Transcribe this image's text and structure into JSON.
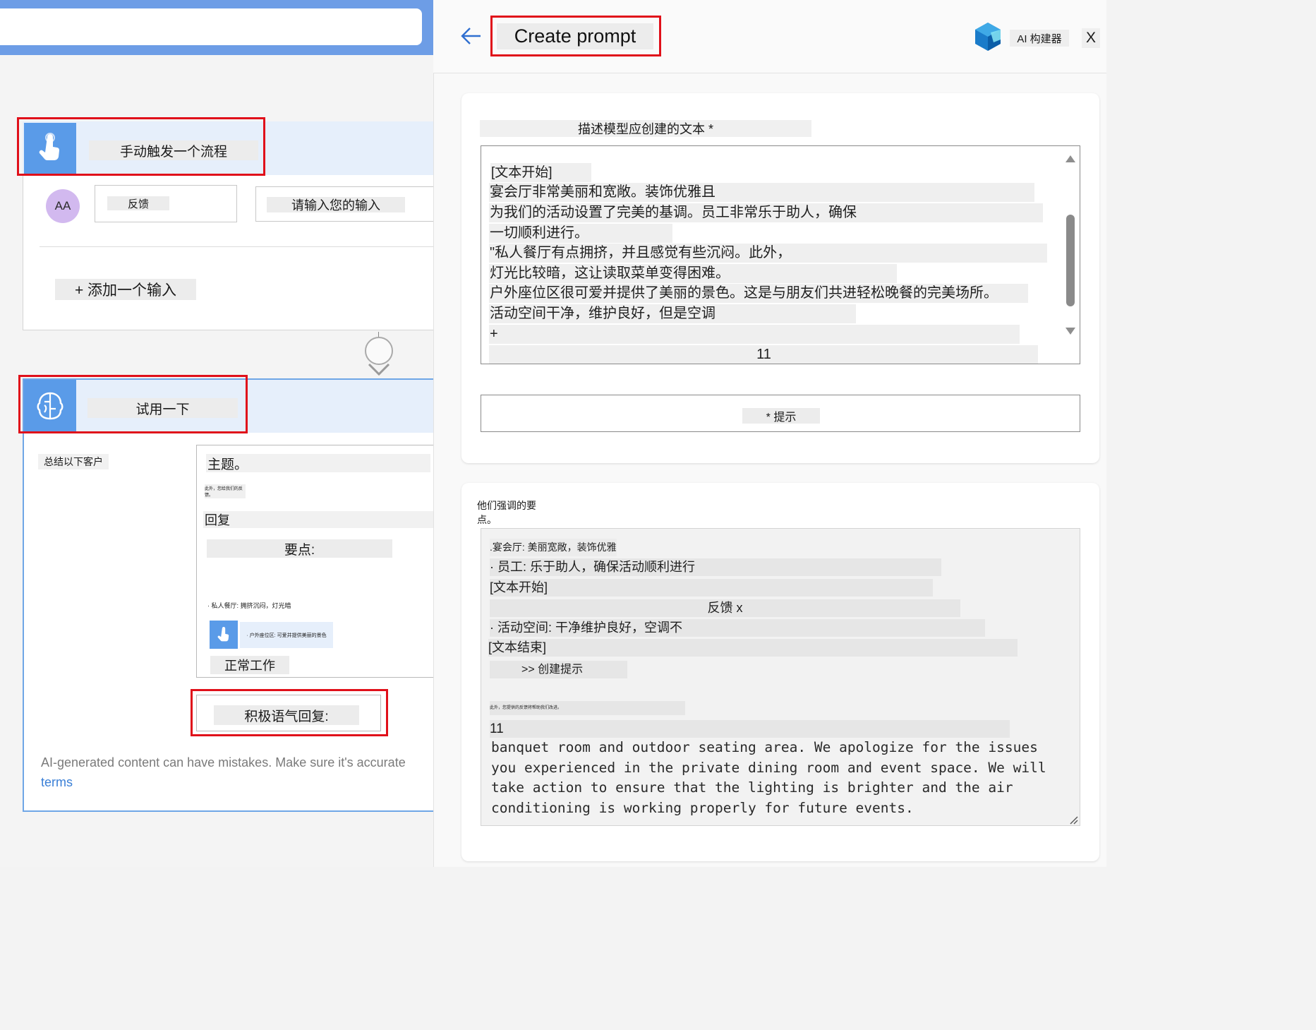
{
  "flow": {
    "trigger": {
      "title": "手动触发一个流程",
      "avatar": "AA",
      "field_name": "反馈",
      "field_placeholder": "请输入您的输入",
      "add_input": "+ 添加一个输入"
    },
    "ai_step": {
      "title": "试用一下",
      "summarize_label": "总结以下客户",
      "preview": {
        "subject": "主题。",
        "tiny_line": "此外，您给我们的反馈。",
        "reply": "回复",
        "key_points": "要点:",
        "private_room": "· 私人餐厅: 拥挤沉闷，灯光暗",
        "outdoor": "· 户外座位区: 可爱并提供美丽的景色",
        "normal": "正常工作"
      },
      "positive_reply": "积极语气回复:",
      "disclaimer": "AI-generated content can have mistakes. Make sure it's accurate",
      "terms_link": "terms"
    }
  },
  "panel": {
    "title": "Create prompt",
    "product_label": "AI 构建器",
    "close_label": "X",
    "description_label": "描述模型应创建的文本 *",
    "prompt_lines": [
      "[文本开始]",
      "宴会厅非常美丽和宽敞。装饰优雅且",
      "为我们的活动设置了完美的基调。员工非常乐于助人，确保",
      "一切顺利进行。",
      "\"私人餐厅有点拥挤，并且感觉有些沉闷。此外，",
      "灯光比较暗，这让读取菜单变得困难。",
      "户外座位区很可爱并提供了美丽的景色。这是与朋友们共进轻松晚餐的完美场所。",
      "活动空间干净，维护良好，但是空调",
      "+",
      "11"
    ],
    "hint_label": "* 提示",
    "key_points_label": "他们强调的要点。",
    "output_lines": [
      ".宴会厅: 美丽宽敞，装饰优雅",
      "· 员工: 乐于助人，确保活动顺利进行",
      "[文本开始]",
      "反馈 x",
      "· 活动空间: 干净维护良好，空调不",
      "[文本结束]",
      ">> 创建提示",
      "此外，您提供的反馈将帮助我们改进。",
      "11"
    ],
    "output_english": "banquet room and outdoor seating area. We apologize for the issues you experienced in the private dining room and event space. We will take action to ensure that the lighting is brighter and the air conditioning is working properly for future events."
  },
  "colors": {
    "accent_blue": "#5a9be8",
    "highlight_red": "#e0101a",
    "link_blue": "#3a7fd6",
    "topbar_blue": "#6d9de6"
  },
  "icons": [
    "hand-touch-icon",
    "ai-brain-icon",
    "back-arrow-icon",
    "ai-builder-logo-icon",
    "chevron-down-icon",
    "scroll-up-icon",
    "scroll-down-icon",
    "resize-grip-icon"
  ]
}
